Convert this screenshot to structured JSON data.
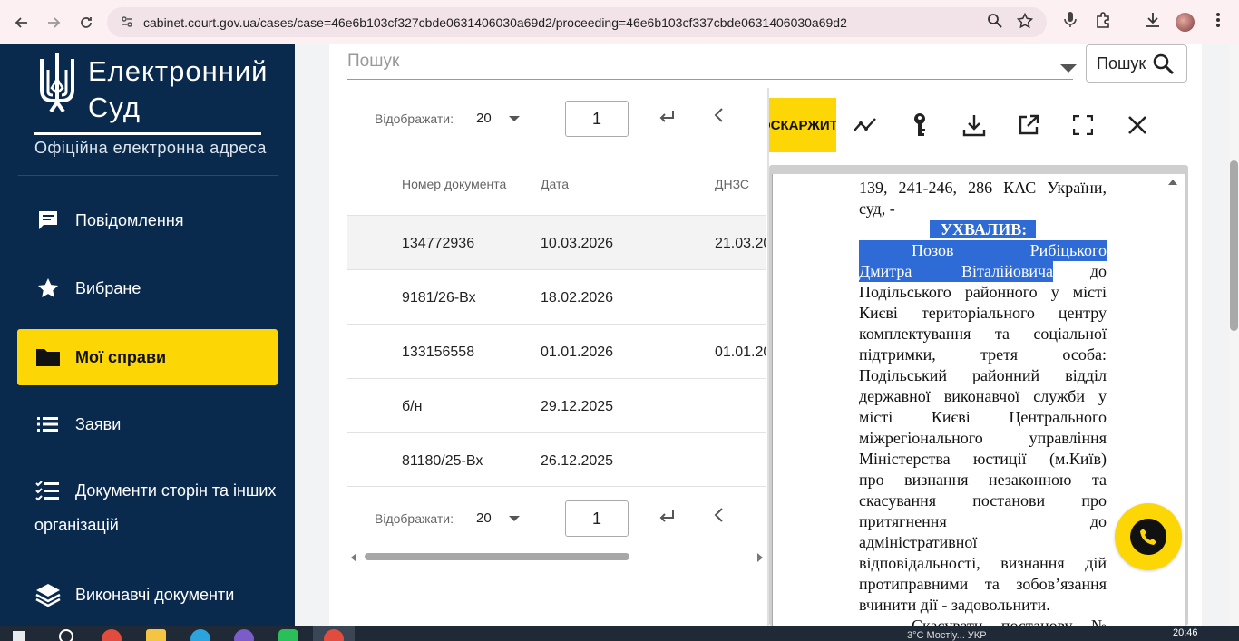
{
  "browser": {
    "url": "cabinet.court.gov.ua/cases/case=46e6b103cf327cbde0631406030a69d2/proceeding=46e6b103cf337cbde0631406030a69d2"
  },
  "sidebar": {
    "logo_title_line1": "Електронний",
    "logo_title_line2": "Суд",
    "logo_subtitle": "Офіційна електронна адреса",
    "items": [
      {
        "label": "Повідомлення",
        "icon": "chat-icon"
      },
      {
        "label": "Вибране",
        "icon": "star-icon"
      },
      {
        "label": "Мої справи",
        "icon": "folder-icon",
        "active": true
      },
      {
        "label": "Заяви",
        "icon": "list-icon"
      },
      {
        "label": "Документи сторін та інших",
        "label2": "організацій",
        "icon": "checklist-icon"
      },
      {
        "label": "Виконавчі документи",
        "icon": "layers-icon"
      }
    ]
  },
  "search": {
    "placeholder": "Пошук",
    "button_label": "Пошук"
  },
  "pager": {
    "label": "Відображати:",
    "size": "20",
    "page": "1"
  },
  "table": {
    "headers": [
      "Номер документа",
      "Дата",
      "ДНЗС"
    ],
    "rows": [
      [
        "134772936",
        "10.03.2026",
        "21.03.20"
      ],
      [
        "9181/26-Вх",
        "18.02.2026",
        ""
      ],
      [
        "133156558",
        "01.01.2026",
        "01.01.20"
      ],
      [
        "б/н",
        "29.12.2025",
        ""
      ],
      [
        "81180/25-Вх",
        "26.12.2025",
        ""
      ]
    ]
  },
  "viewer": {
    "appeal_label": "ОСКАРЖИТИ",
    "doc_line_top1": "139, 241-246, 286 КАС України,",
    "doc_line_top2": "суд, -",
    "doc_heading": "УХВАЛИВ:",
    "doc_sel_line1": "Позов Рибіцького",
    "doc_sel_line2a": "Дмитра Віталійовича",
    "doc_sel_line2b": " до",
    "doc_body": [
      "Подільського районного у місті",
      "Києві територіального центру",
      "комплектування та соціальної",
      "підтримки, третя особа:",
      "Подільський районний відділ",
      "державної виконавчої служби у",
      "місті Києві Центрального",
      "міжрегіонального управління",
      "Міністерства юстиції (м.Київ)",
      "про визнання незаконною та",
      "скасування постанови про",
      "притягнення до"
    ],
    "doc_body_left": [
      "адміністративної"
    ],
    "doc_body_tail": [
      "відповідальності, визнання дій",
      "протиправними та зобов’язання"
    ],
    "doc_body_last": "вчинити дії - задовольнити.",
    "doc_next": "Скасувати постанову №"
  },
  "taskbar": {
    "time": "20:46",
    "weather": "3°С   Мостly...   УКР"
  },
  "colors": {
    "sidebar_bg": "#0a2a4d",
    "accent_yellow": "#fdd605",
    "selection": "#2f6bd6"
  }
}
